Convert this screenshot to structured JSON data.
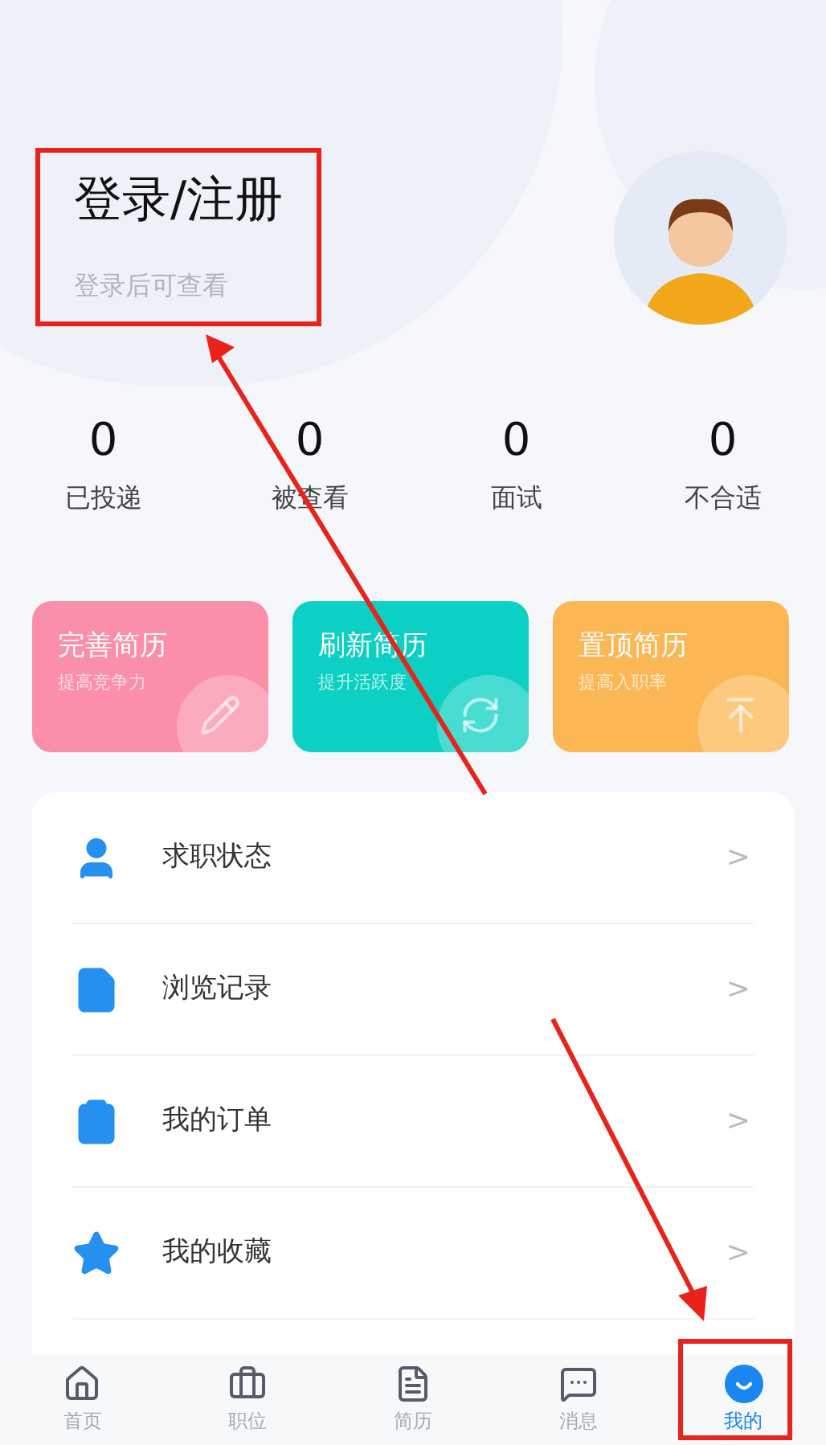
{
  "profile": {
    "title": "登录/注册",
    "subtitle": "登录后可查看"
  },
  "stats": [
    {
      "value": "0",
      "label": "已投递"
    },
    {
      "value": "0",
      "label": "被查看"
    },
    {
      "value": "0",
      "label": "面试"
    },
    {
      "value": "0",
      "label": "不合适"
    }
  ],
  "cards": [
    {
      "title": "完善简历",
      "subtitle": "提高竞争力",
      "color": "#fb8fa9"
    },
    {
      "title": "刷新简历",
      "subtitle": "提升活跃度",
      "color": "#0cd0c3"
    },
    {
      "title": "置顶简历",
      "subtitle": "提高入职率",
      "color": "#fbb754"
    }
  ],
  "menu": [
    {
      "label": "求职状态",
      "arrow": ">"
    },
    {
      "label": "浏览记录",
      "arrow": ">"
    },
    {
      "label": "我的订单",
      "arrow": ">"
    },
    {
      "label": "我的收藏",
      "arrow": ">"
    }
  ],
  "tabs": [
    {
      "label": "首页",
      "selected": false
    },
    {
      "label": "职位",
      "selected": false
    },
    {
      "label": "简历",
      "selected": false
    },
    {
      "label": "消息",
      "selected": false
    },
    {
      "label": "我的",
      "selected": true
    }
  ]
}
